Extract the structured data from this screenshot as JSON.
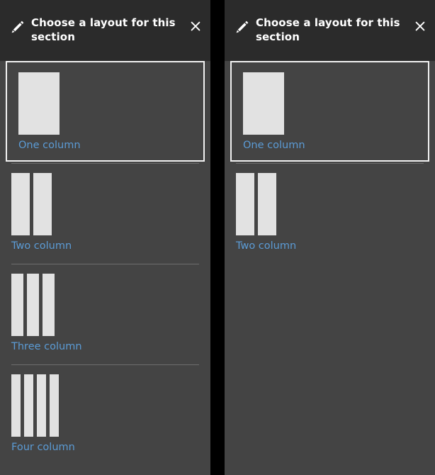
{
  "panels": [
    {
      "id": "panel-left",
      "header": {
        "icon": "pencil-icon",
        "title": "Choose a layout for this section",
        "close_icon": "close-icon",
        "close_label": "×"
      },
      "options": [
        {
          "label": "One column",
          "columns": 1,
          "selected": true
        },
        {
          "label": "Two column",
          "columns": 2,
          "selected": false
        },
        {
          "label": "Three column",
          "columns": 3,
          "selected": false
        },
        {
          "label": "Four column",
          "columns": 4,
          "selected": false
        }
      ]
    },
    {
      "id": "panel-right",
      "header": {
        "icon": "pencil-icon",
        "title": "Choose a layout for this section",
        "close_icon": "close-icon",
        "close_label": "×"
      },
      "options": [
        {
          "label": "One column",
          "columns": 1,
          "selected": true
        },
        {
          "label": "Two column",
          "columns": 2,
          "selected": false
        }
      ]
    }
  ],
  "colors": {
    "panel_background": "#444444",
    "header_background": "#2b2b2b",
    "gap_background": "#000000",
    "link_text": "#5b9bd5",
    "title_text": "#ffffff",
    "thumbnail_fill": "#e2e2e2",
    "selected_border": "#f2f2f2",
    "divider": "#6d6d6d"
  }
}
